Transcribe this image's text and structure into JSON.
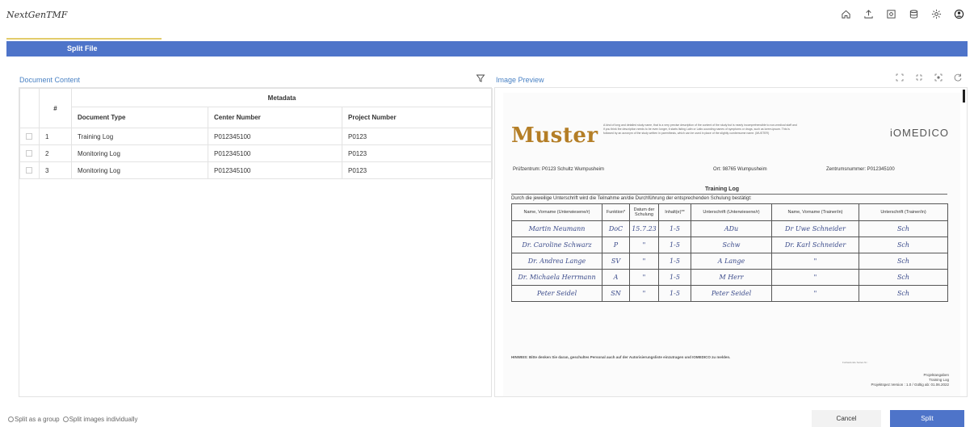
{
  "app": {
    "title": "NextGenTMF"
  },
  "topbar": {
    "icons": [
      "home-icon",
      "upload-icon",
      "image-icon",
      "database-icon",
      "settings-icon",
      "user-icon"
    ]
  },
  "dialog": {
    "title": "Split File"
  },
  "left_panel": {
    "header": "Document Content",
    "table": {
      "group_header": "Metadata",
      "index_header": "#",
      "columns": [
        "Document Type",
        "Center Number",
        "Project Number"
      ],
      "rows": [
        {
          "index": "1",
          "document_type": "Training Log",
          "center_number": "P012345100",
          "project_number": "P0123"
        },
        {
          "index": "2",
          "document_type": "Monitoring Log",
          "center_number": "P012345100",
          "project_number": "P0123"
        },
        {
          "index": "3",
          "document_type": "Monitoring Log",
          "center_number": "P012345100",
          "project_number": "P0123"
        }
      ]
    }
  },
  "right_panel": {
    "header": "Image Preview",
    "document": {
      "logo": "Muster",
      "brand": "iOMEDICO",
      "description": "A kind of long and detailed study name, that is a very precise description of the content of the study but is nearly incomprehensible to non-medical staff and if you think the description needs to be even longer, it starts listing Latin or Latin-sounding names of symptoms or drugs, such as lorem-ipsum. This is followed by an acronym of the study written in parenthesis, which can be used in place of the slightly cumbersome name. (MUSTER)",
      "pruefzentrum": "Prüfzentrum: P0123 Schultz Wumpusheim",
      "ort": "Ort: 98765 Wumpusheim",
      "zentrumsnummer": "Zentrumsnummer: P012345100",
      "title": "Training Log",
      "subtitle": "Durch die jeweilige Unterschrift wird die Teilnahme an/die Durchführung der entsprechenden Schulung bestätigt:",
      "columns": [
        "Name, Vorname (Unterwiesene/r)",
        "Funktion*",
        "Datum der Schulung",
        "Inhalt(e)**",
        "Unterschrift (Unterwiesene/r)",
        "Name, Vorname (Trainer/in)",
        "Unterschrift (Trainer/in)"
      ],
      "rows": [
        [
          "Martin Neumann",
          "DoC",
          "15.7.23",
          "1-5",
          "ADu",
          "Dr Uwe Schneider",
          "Sch"
        ],
        [
          "Dr. Caroline Schwarz",
          "P",
          "\"",
          "1-5",
          "Schw",
          "Dr. Karl Schneider",
          "Sch"
        ],
        [
          "Dr. Andrea Lange",
          "SV",
          "\"",
          "1-5",
          "A Lange",
          "\"",
          "Sch"
        ],
        [
          "Dr. Michaela Herrmann",
          "A",
          "\"",
          "1-5",
          "M Herr",
          "\"",
          "Sch"
        ],
        [
          "Peter Seidel",
          "SN",
          "\"",
          "1-5",
          "Peter Seidel",
          "\"",
          "Sch"
        ]
      ],
      "hinweis": "HINWEIS: Bitte denken Sie daran, geschultes Personal auch auf der Autorisierungsliste einzutragen und IOMEDICO zu melden.",
      "fortlaufende": "Fortlaufende Seiten-Nr.:",
      "footer": [
        "Projektangaben",
        "Training Log",
        "Projektspez.Version : 1.0 / Gültig ab: 01.06.2022"
      ]
    }
  },
  "footer": {
    "radio_group": "Split as a group",
    "radio_individual": "Split images individually",
    "cancel": "Cancel",
    "split": "Split"
  },
  "colors": {
    "primary": "#4e74c9",
    "accent": "#e3cc6b",
    "link": "#4a82c4"
  }
}
